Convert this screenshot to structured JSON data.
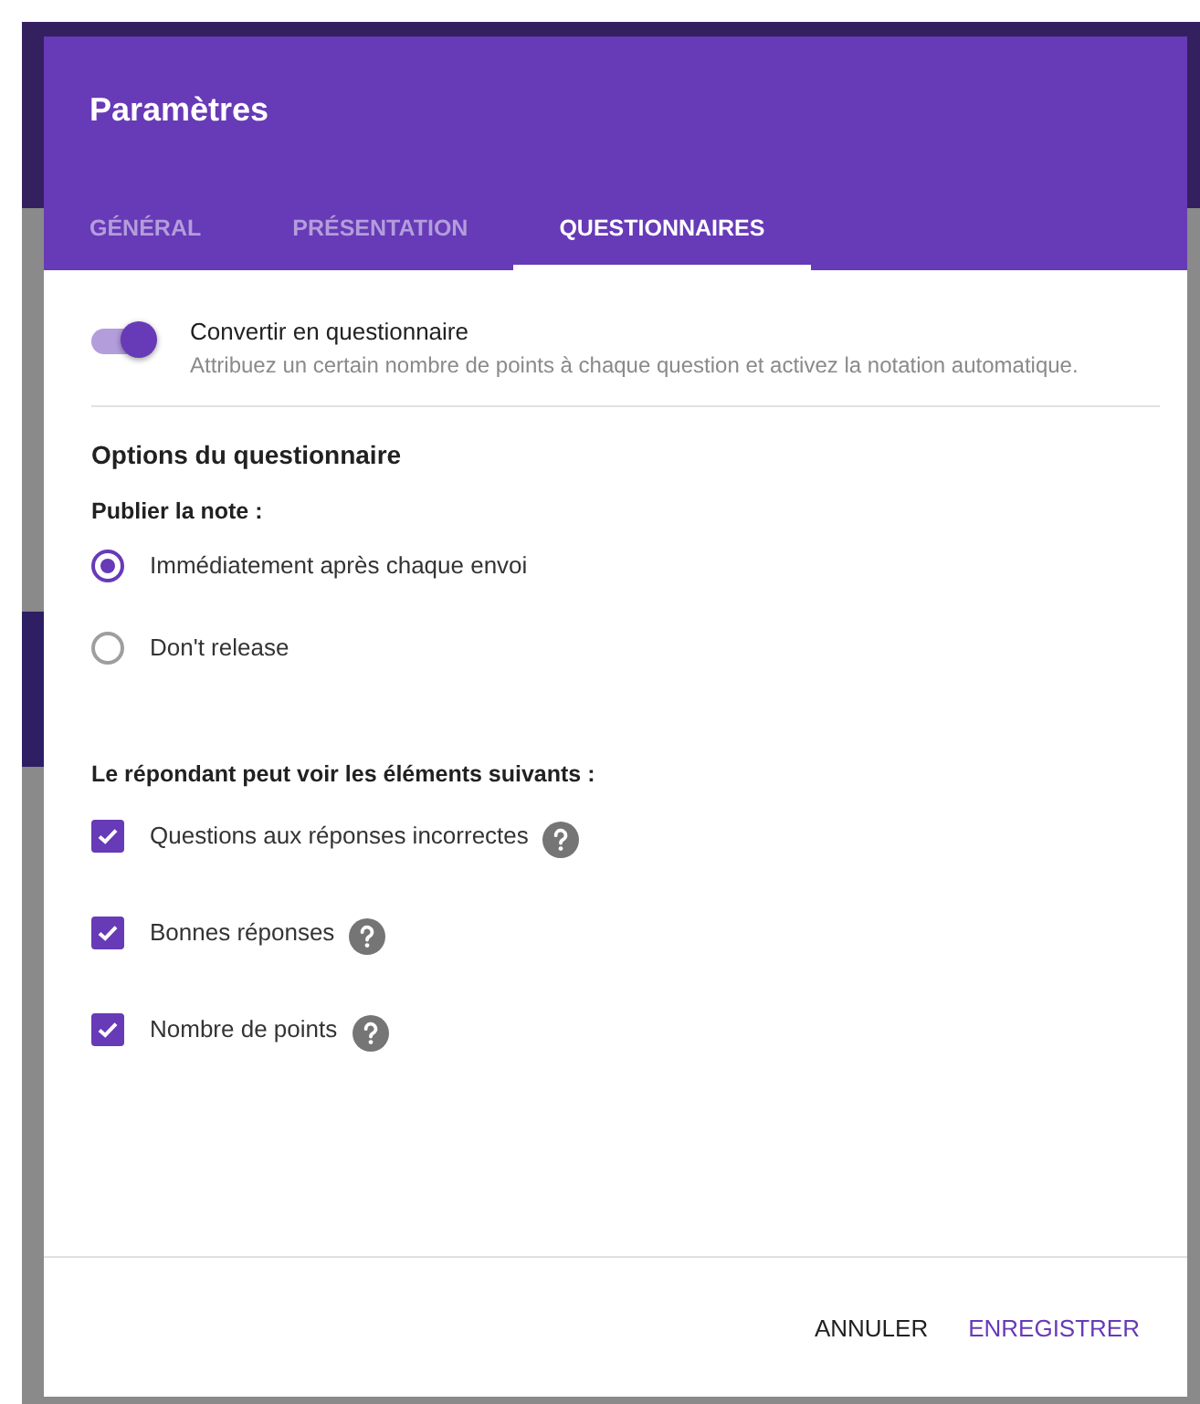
{
  "dialog": {
    "title": "Paramètres",
    "tabs": [
      {
        "label": "GÉNÉRAL",
        "selected": false
      },
      {
        "label": "PRÉSENTATION",
        "selected": false
      },
      {
        "label": "QUESTIONNAIRES",
        "selected": true
      }
    ],
    "quiz_toggle": {
      "label": "Convertir en questionnaire",
      "description": "Attribuez un certain nombre de points à chaque question et activez la notation automatique.",
      "on": true
    },
    "section_title": "Options du questionnaire",
    "release": {
      "label": "Publier la note :",
      "options": [
        {
          "label": "Immédiatement après chaque envoi",
          "selected": true
        },
        {
          "label": "Don't release",
          "selected": false
        }
      ]
    },
    "visibility": {
      "label": "Le répondant peut voir les éléments suivants :",
      "options": [
        {
          "label": "Questions aux réponses incorrectes",
          "checked": true
        },
        {
          "label": "Bonnes réponses",
          "checked": true
        },
        {
          "label": "Nombre de points",
          "checked": true
        }
      ]
    },
    "buttons": [
      {
        "label": "ANNULER",
        "kind": "secondary"
      },
      {
        "label": "ENREGISTRER",
        "kind": "primary"
      }
    ]
  }
}
